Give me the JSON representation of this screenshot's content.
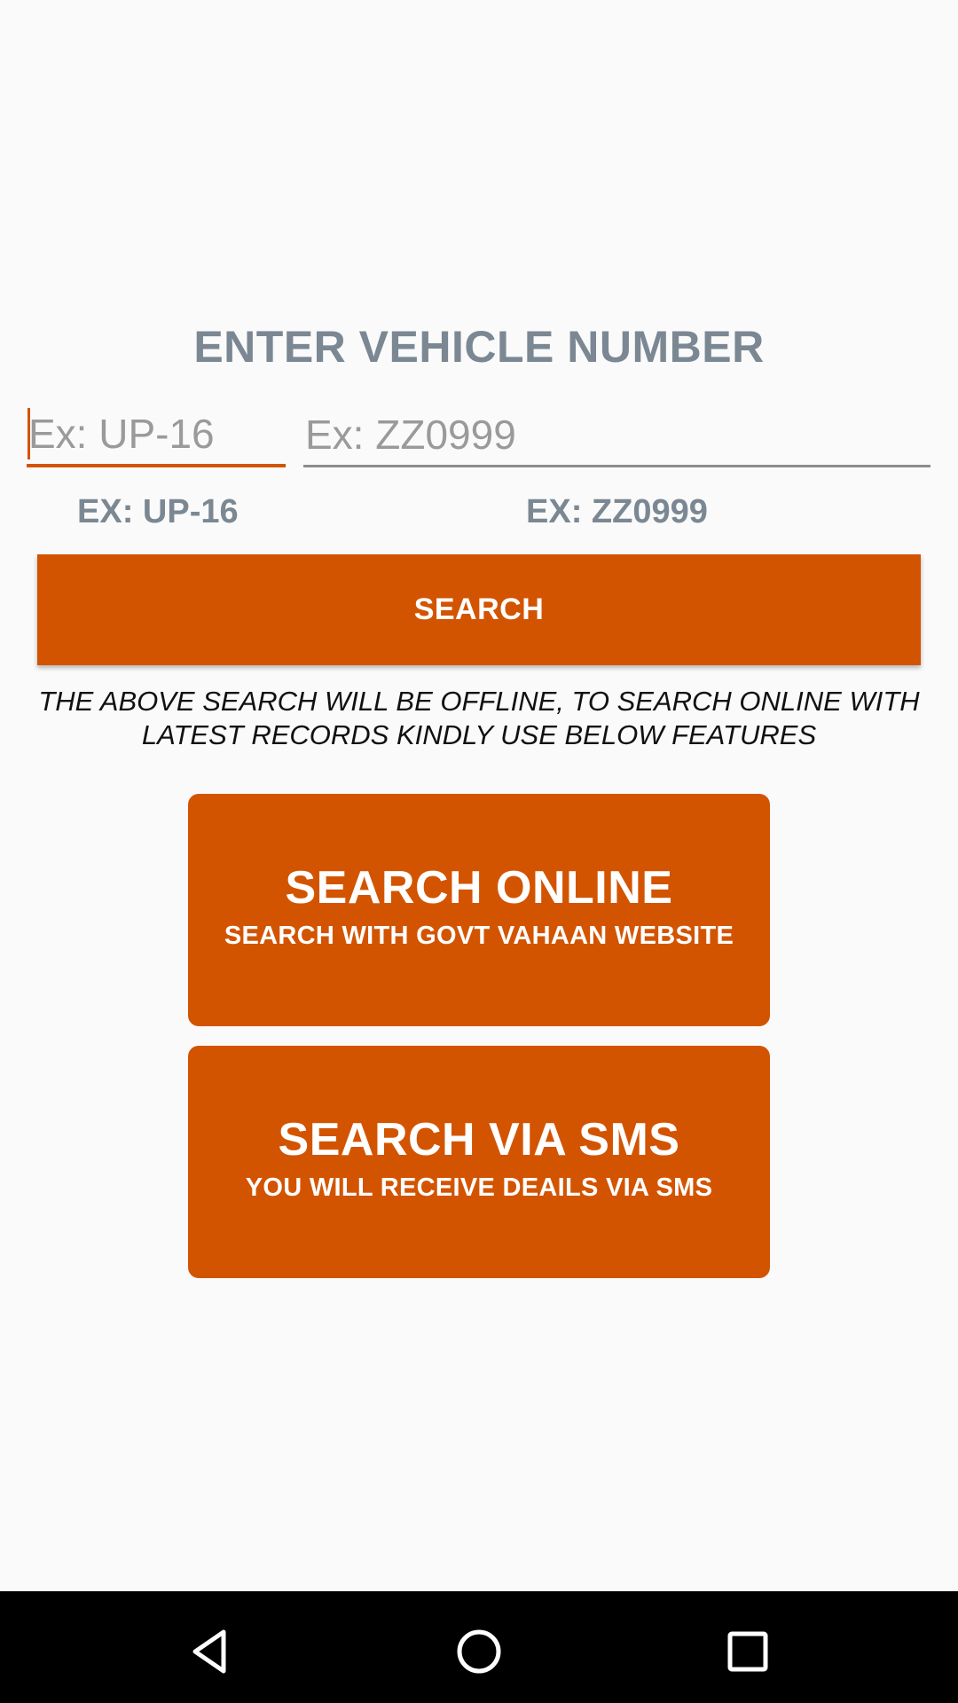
{
  "header": {
    "title": "ENTER VEHICLE NUMBER"
  },
  "form": {
    "state_field": {
      "value": "",
      "placeholder": "Ex: UP-16"
    },
    "number_field": {
      "value": "",
      "placeholder": "Ex: ZZ0999"
    },
    "state_hint": "EX: UP-16",
    "number_hint": "EX: ZZ0999",
    "search_label": "SEARCH"
  },
  "notice": "THE ABOVE SEARCH WILL BE OFFLINE, TO SEARCH ONLINE WITH LATEST RECORDS KINDLY USE BELOW FEATURES",
  "actions": {
    "online": {
      "title": "SEARCH ONLINE",
      "subtitle": "SEARCH WITH GOVT VAHAAN WEBSITE"
    },
    "sms": {
      "title": "SEARCH VIA SMS",
      "subtitle": "YOU WILL RECEIVE DEAILS VIA SMS"
    }
  },
  "colors": {
    "accent": "#d35400",
    "muted_text": "#7b8893",
    "background": "#fafafa"
  },
  "navbar": {
    "icons": [
      "back-icon",
      "home-icon",
      "recent-apps-icon"
    ]
  }
}
